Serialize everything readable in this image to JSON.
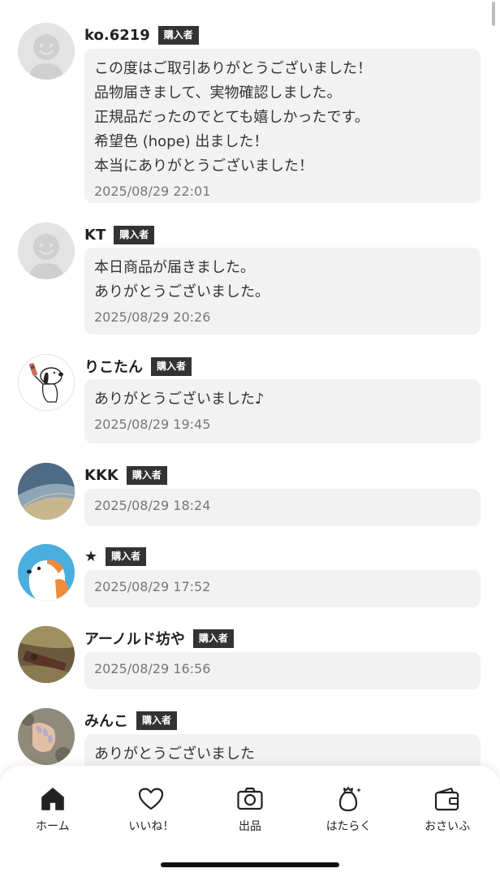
{
  "badge_label": "購入者",
  "reviews": [
    {
      "name": "ko.6219",
      "avatar": "default-person-icon",
      "comment": "この度はご取引ありがとうございました！\n品物届きまして、実物確認しました。\n正規品だったのでとても嬉しかったです。\n希望色 (hope) 出ました！\n本当にありがとうございました！",
      "time": "2025/08/29 22:01"
    },
    {
      "name": "KT",
      "avatar": "default-person-icon",
      "comment": "本日商品が届きました。\nありがとうございました。",
      "time": "2025/08/29 20:26"
    },
    {
      "name": "りこたん",
      "avatar": "snoopy-photo",
      "comment": "ありがとうございました♪",
      "time": "2025/08/29 19:45"
    },
    {
      "name": "KKK",
      "avatar": "denim-photo",
      "comment": "",
      "time": "2025/08/29 18:24"
    },
    {
      "name": "★",
      "avatar": "dog-illustration",
      "comment": "",
      "time": "2025/08/29 17:52"
    },
    {
      "name": "アーノルド坊や",
      "avatar": "outdoor-photo",
      "comment": "",
      "time": "2025/08/29 16:56"
    },
    {
      "name": "みんこ",
      "avatar": "nails-photo",
      "comment": "ありがとうございました",
      "time": ""
    }
  ],
  "tabbar": {
    "items": [
      {
        "label": "ホーム",
        "icon": "home-icon",
        "active": true
      },
      {
        "label": "いいね！",
        "icon": "heart-icon",
        "active": false
      },
      {
        "label": "出品",
        "icon": "camera-icon",
        "active": false
      },
      {
        "label": "はたらく",
        "icon": "money-bag-icon",
        "active": false
      },
      {
        "label": "おさいふ",
        "icon": "wallet-icon",
        "active": false
      }
    ]
  }
}
